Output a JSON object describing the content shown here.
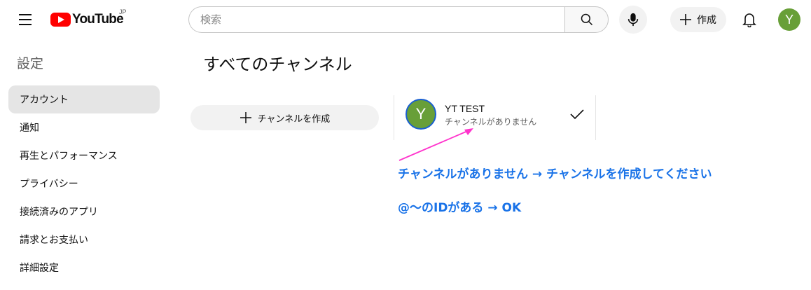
{
  "header": {
    "logo_text": "YouTube",
    "logo_region": "JP",
    "search_placeholder": "検索",
    "create_label": "作成",
    "avatar_letter": "Y"
  },
  "sidebar": {
    "title": "設定",
    "items": [
      {
        "label": "アカウント",
        "active": true
      },
      {
        "label": "通知"
      },
      {
        "label": "再生とパフォーマンス"
      },
      {
        "label": "プライバシー"
      },
      {
        "label": "接続済みのアプリ"
      },
      {
        "label": "請求とお支払い"
      },
      {
        "label": "詳細設定"
      }
    ]
  },
  "main": {
    "title": "すべてのチャンネル",
    "create_channel_label": "チャンネルを作成",
    "channel": {
      "avatar_letter": "Y",
      "name": "YT TEST",
      "subtitle": "チャンネルがありません"
    }
  },
  "annotations": {
    "line1": "チャンネルがありません → チャンネルを作成してください",
    "line2": "@～のIDがある → OK",
    "arrow_color": "#ff33cc",
    "text_color": "#1a73e8"
  },
  "colors": {
    "avatar_bg": "#689f38",
    "logo_red": "#ff0000",
    "active_item_bg": "#e5e5e5"
  }
}
